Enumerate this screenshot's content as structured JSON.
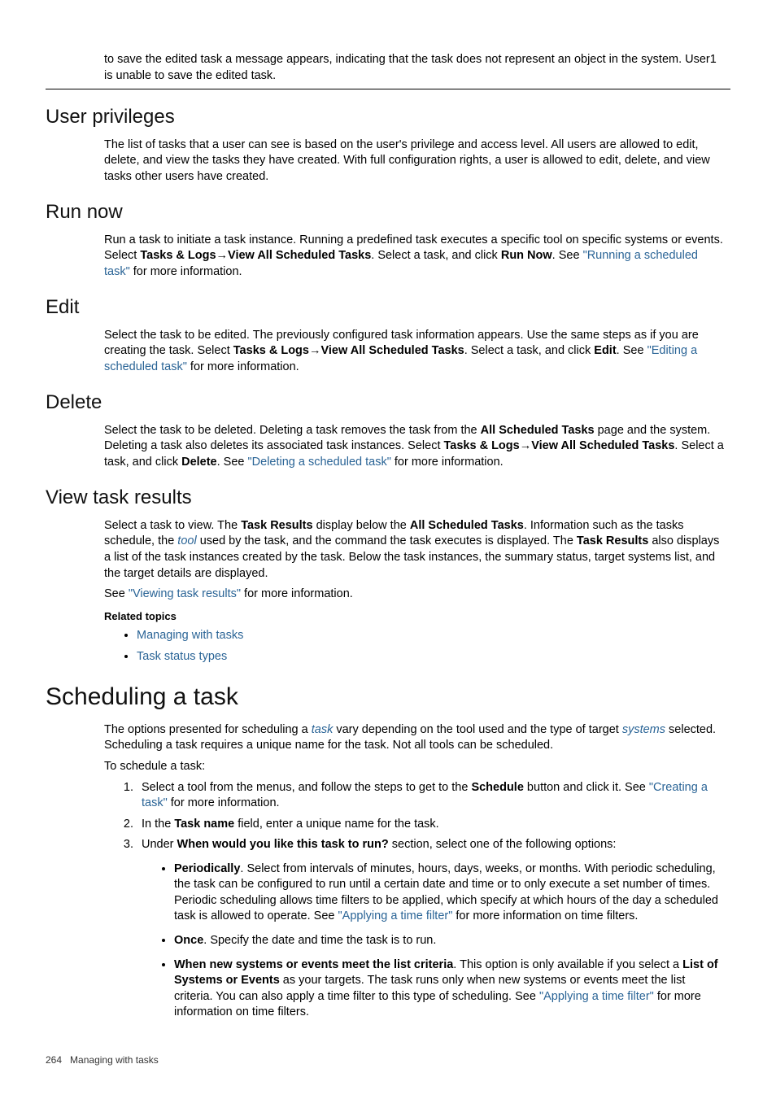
{
  "intro": {
    "para": "to save the edited task a message appears, indicating that the task does not represent an object in the system. User1 is unable to save the edited task."
  },
  "user_privileges": {
    "heading": "User privileges",
    "para": "The list of tasks that a user can see is based on the user's privilege and access level. All users are allowed to edit, delete, and view the tasks they have created. With full configuration rights, a user is allowed to edit, delete, and view tasks other users have created."
  },
  "run_now": {
    "heading": "Run now",
    "para_pre": "Run a task to initiate a task instance. Running a predefined task executes a specific tool on specific systems or events. Select ",
    "b1": "Tasks & Logs",
    "arrow": "→",
    "b2": "View All Scheduled Tasks",
    "mid": ". Select a task, and click ",
    "b3": "Run Now",
    "after": ". See ",
    "link": "\"Running a scheduled task\"",
    "end": " for more information."
  },
  "edit": {
    "heading": "Edit",
    "para_pre": "Select the task to be edited. The previously configured task information appears. Use the same steps as if you are creating the task. Select ",
    "b1": "Tasks & Logs",
    "arrow": "→",
    "b2": "View All Scheduled Tasks",
    "mid": ". Select a task, and click ",
    "b3": "Edit",
    "after": ". See ",
    "link": "\"Editing a scheduled task\"",
    "end": " for more information."
  },
  "delete": {
    "heading": "Delete",
    "p1_pre": "Select the task to be deleted. Deleting a task removes the task from the ",
    "p1_b1": "All Scheduled Tasks",
    "p1_mid1": " page and the system. Deleting a task also deletes its associated task instances. Select ",
    "p1_b2": "Tasks & Logs",
    "arrow": "→",
    "p1_b3": "View All Scheduled Tasks",
    "p1_mid2": ". Select a task, and click ",
    "p1_b4": "Delete",
    "p1_after": ". See ",
    "p1_link": "\"Deleting a scheduled task\"",
    "p1_end": " for more information."
  },
  "view_results": {
    "heading": "View task results",
    "p1_pre": "Select a task to view. The ",
    "p1_b1": "Task Results",
    "p1_mid1": " display below the ",
    "p1_b2": "All Scheduled Tasks",
    "p1_mid2": ". Information such as the tasks schedule, the ",
    "p1_gloss": "tool",
    "p1_mid3": " used by the task, and the command the task executes is displayed. The ",
    "p1_b3": "Task Results",
    "p1_end": " also displays a list of the task instances created by the task. Below the task instances, the summary status, target systems list, and the target details are displayed.",
    "p2_pre": "See ",
    "p2_link": "\"Viewing task results\"",
    "p2_end": " for more information.",
    "related_hdr": "Related topics",
    "rel1": "Managing with tasks",
    "rel2": "Task status types"
  },
  "scheduling": {
    "heading": "Scheduling a task",
    "p1_pre": "The options presented for scheduling a ",
    "p1_g1": "task",
    "p1_mid": " vary depending on the tool used and the type of target ",
    "p1_g2": "systems",
    "p1_end": " selected. Scheduling a task requires a unique name for the task. Not all tools can be scheduled.",
    "p2": "To schedule a task:",
    "step1_pre": "Select a tool from the menus, and follow the steps to get to the ",
    "step1_b": "Schedule",
    "step1_mid": " button and click it. See ",
    "step1_link": "\"Creating a task\"",
    "step1_end": " for more information.",
    "step2_pre": "In the ",
    "step2_b": "Task name",
    "step2_end": " field, enter a unique name for the task.",
    "step3_pre": "Under ",
    "step3_b": "When would you like this task to run?",
    "step3_end": " section, select one of the following options:",
    "opt1_b": "Periodically",
    "opt1_text": ". Select from intervals of minutes, hours, days, weeks, or months. With periodic scheduling, the task can be configured to run until a certain date and time or to only execute a set number of times. Periodic scheduling allows time filters to be applied, which specify at which hours of the day a scheduled task is allowed to operate. See ",
    "opt1_link": "\"Applying a time filter\"",
    "opt1_end": " for more information on time filters.",
    "opt2_b": "Once",
    "opt2_text": ". Specify the date and time the task is to run.",
    "opt3_b1": "When new systems or events meet the list criteria",
    "opt3_mid1": ". This option is only available if you select a ",
    "opt3_b2": "List of Systems or Events",
    "opt3_mid2": " as your targets. The task runs only when new systems or events meet the list criteria. You can also apply a time filter to this type of scheduling. See ",
    "opt3_link": "\"Applying a time filter\"",
    "opt3_end": " for more information on time filters."
  },
  "footer": {
    "pagenum": "264",
    "title": "Managing with tasks"
  }
}
